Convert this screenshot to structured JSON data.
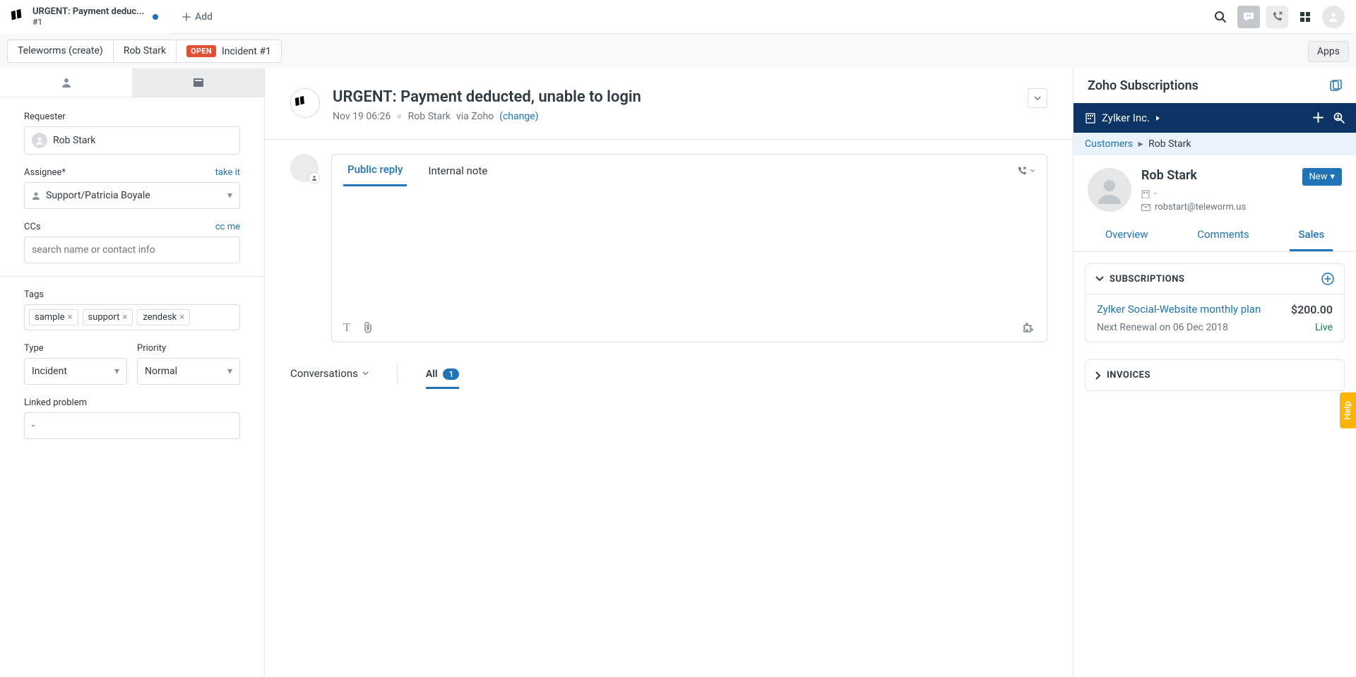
{
  "topbar": {
    "tab_title": "URGENT: Payment deduc...",
    "tab_sub": "#1",
    "add_label": "Add"
  },
  "secondbar": {
    "pill1": "Teleworms (create)",
    "pill2": "Rob Stark",
    "open_badge": "OPEN",
    "pill3": "Incident #1",
    "apps": "Apps"
  },
  "sidebar": {
    "requester_label": "Requester",
    "requester_value": "Rob Stark",
    "assignee_label": "Assignee*",
    "take_it": "take it",
    "assignee_value": "Support/Patricia Boyale",
    "ccs_label": "CCs",
    "cc_me": "cc me",
    "ccs_placeholder": "search name or contact info",
    "tags_label": "Tags",
    "tags": [
      "sample",
      "support",
      "zendesk"
    ],
    "type_label": "Type",
    "type_value": "Incident",
    "priority_label": "Priority",
    "priority_value": "Normal",
    "linked_label": "Linked problem",
    "linked_value": "-"
  },
  "ticket": {
    "title": "URGENT: Payment deducted, unable to login",
    "time": "Nov 19 06:26",
    "requester": "Rob Stark",
    "via": "via Zoho",
    "change": "(change)"
  },
  "reply": {
    "public": "Public reply",
    "internal": "Internal note"
  },
  "conversations": {
    "label": "Conversations",
    "all": "All",
    "count": "1"
  },
  "zoho": {
    "title": "Zoho Subscriptions",
    "org": "Zylker Inc.",
    "bc_customers": "Customers",
    "bc_current": "Rob Stark",
    "cust_name": "Rob Stark",
    "new_btn": "New",
    "company_line": "-",
    "email": "robstart@teleworm.us",
    "tab_overview": "Overview",
    "tab_comments": "Comments",
    "tab_sales": "Sales",
    "subs_title": "SUBSCRIPTIONS",
    "plan_name": "Zylker Social-Website monthly plan",
    "plan_price": "$200.00",
    "renewal": "Next Renewal on 06 Dec 2018",
    "status": "Live",
    "invoices_title": "INVOICES"
  },
  "help": "Help"
}
